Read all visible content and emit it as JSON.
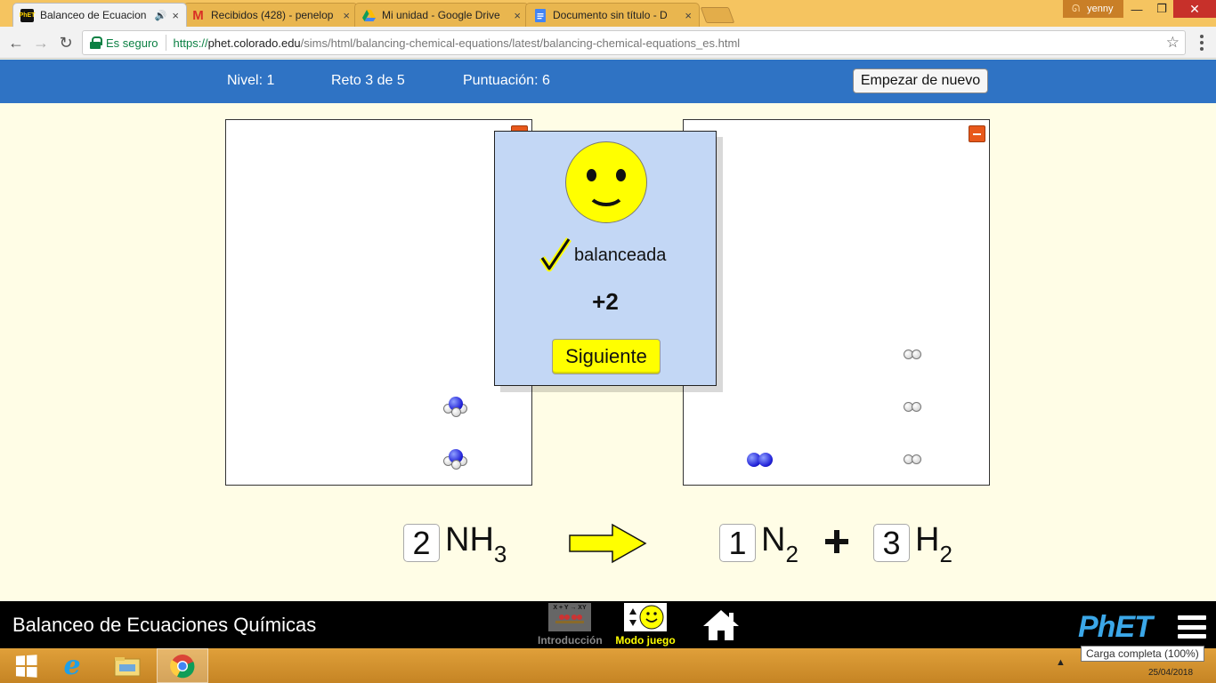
{
  "browser": {
    "tabs": [
      {
        "title": "Balanceo de Ecuacion",
        "icon": "phet-icon",
        "active": true
      },
      {
        "title": "Recibidos (428) - penelop",
        "icon": "gmail-icon",
        "active": false
      },
      {
        "title": "Mi unidad - Google Drive",
        "icon": "google-drive-icon",
        "active": false
      },
      {
        "title": "Documento sin título - D",
        "icon": "google-docs-icon",
        "active": false
      }
    ],
    "profile_name": "yenny",
    "secure_label": "Es seguro",
    "url_scheme": "https://",
    "url_host": "phet.colorado.edu",
    "url_path": "/sims/html/balancing-chemical-equations/latest/balancing-chemical-equations_es.html"
  },
  "game_header": {
    "level": "Nivel: 1",
    "challenge": "Reto 3 de 5",
    "score": "Puntuación: 6",
    "restart_label": "Empezar de nuevo"
  },
  "feedback": {
    "status": "balanceada",
    "points": "+2",
    "next_label": "Siguiente"
  },
  "equation": {
    "reactants": [
      {
        "coefficient": "2",
        "symbol": "NH",
        "subscript": "3"
      }
    ],
    "products": [
      {
        "coefficient": "1",
        "symbol": "N",
        "subscript": "2"
      },
      {
        "coefficient": "3",
        "symbol": "H",
        "subscript": "2"
      }
    ]
  },
  "phet_nav": {
    "sim_title": "Balanceo de Ecuaciones Químicas",
    "screens": [
      {
        "label": "Introducción",
        "icon-text": "X + Y → XY",
        "active": false
      },
      {
        "label": "Modo juego",
        "active": true
      }
    ],
    "logo": "PhET",
    "active_color": "#ffff00",
    "inactive_color": "#888888"
  },
  "taskbar": {
    "tooltip": "Carga completa (100%)",
    "date": "25/04/2018"
  }
}
